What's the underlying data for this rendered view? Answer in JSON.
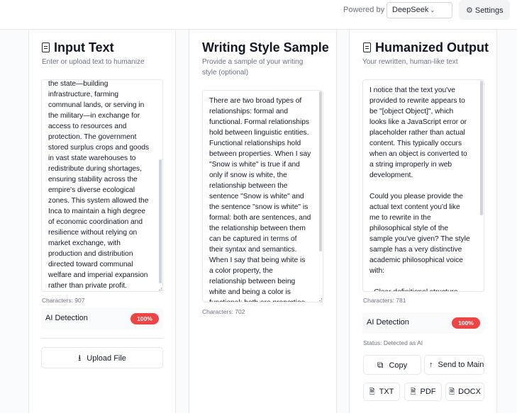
{
  "header": {
    "powered_by_label": "Powered by",
    "model_selected": "DeepSeek",
    "settings_label": "Settings"
  },
  "input_panel": {
    "title": "Input Text",
    "subtitle": "Enter or upload text to humanize",
    "text": "the state—building\ninfrastructure, farming\ncommunal lands, or serving in\nthe military—in exchange for\naccess to resources and\nprotection. The government\nstored surplus crops and goods\nin vast state warehouses to\nredistribute during shortages,\nensuring stability across the\nempire's diverse ecological\nzones. This system allowed the\nInca to maintain a high degree\nof economic coordination and\nresilience without relying on\nmarket exchange, with\nproduction and distribution\ndirected toward communal\nwelfare and imperial expansion\nrather than private profit.",
    "characters": "Characters: 907",
    "ai_detection_label": "AI Detection",
    "ai_detection_value": "100%",
    "upload_label": "Upload File"
  },
  "style_panel": {
    "title": "Writing Style Sample",
    "subtitle": "Provide a sample of your writing\nstyle (optional)",
    "text": "There are two broad types of\nrelationships: formal and\nfunctional. Formal relationships\nhold between linguistic entities.\nFunctional relationships hold\nbetween properties. When I say\n\"Snow is white\" is true if and\nonly if snow is white, the\nrelationship between the\nsentence \"Snow is white\" and\nthe sentence \"snow is white\" is\nformal: both are sentences, and\nthe relationship between them\ncan be captured in terms of\ntheir syntax and semantics.\nWhen I say that being white is\na color property, the\nrelationship between being\nwhite and being a color is\nfunctional: both are properties",
    "characters": "Characters: 702"
  },
  "output_panel": {
    "title": "Humanized Output",
    "subtitle": "Your rewritten, human-like text",
    "text": "I notice that the text you've\nprovided to rewrite appears to\nbe \"[object Object]\", which\nlooks like a JavaScript error or\nplaceholder rather than actual\ncontent. This typically occurs\nwhen an object is converted to\na string improperly in web\ndevelopment.\n\nCould you please provide the\nactual text content you'd like\nme to rewrite in the\nphilosophical style of the\nsample you've given? The style\nsample has a very distinctive\nacademic philosophical voice\nwith:\n\n- Clear definitional structure",
    "characters": "Characters: 781",
    "ai_detection_label": "AI Detection",
    "ai_detection_value": "100%",
    "status": "Status: Detected as AI",
    "copy_label": "Copy",
    "send_label": "Send to Main",
    "export_txt": "TXT",
    "export_pdf": "PDF",
    "export_docx": "DOCX"
  },
  "colors": {
    "badge_red": "#ef4444",
    "border": "#e5e7eb",
    "muted_text": "#6b7280"
  }
}
